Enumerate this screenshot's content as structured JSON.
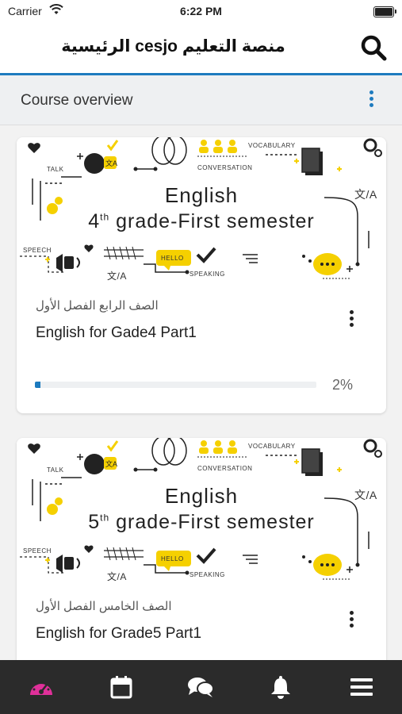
{
  "status_bar": {
    "carrier": "Carrier",
    "time": "6:22 PM"
  },
  "header": {
    "title": "الرئيسية cesjo منصة التعليم"
  },
  "overview": {
    "label": "Course overview"
  },
  "courses": [
    {
      "banner_title": "English",
      "banner_grade_num": "4",
      "banner_grade_sup": "th",
      "banner_grade_text": "grade-First semester",
      "category": "الصف الرابع الفصل الأول",
      "name": "English for Gade4 Part1",
      "progress": 2,
      "progress_label": "2%"
    },
    {
      "banner_title": "English",
      "banner_grade_num": "5",
      "banner_grade_sup": "th",
      "banner_grade_text": "grade-First semester",
      "category": "الصف الخامس الفصل الأول",
      "name": "English for Grade5 Part1"
    }
  ],
  "banner_tags": {
    "talk": "TALK",
    "vocabulary": "VOCABULARY",
    "conversation": "CONVERSATION",
    "speech": "SPEECH",
    "speaking": "SPEAKING",
    "hello": "HELLO",
    "translate": "文/A"
  },
  "tabs": [
    {
      "icon": "dashboard-icon",
      "active": true
    },
    {
      "icon": "calendar-icon"
    },
    {
      "icon": "messages-icon"
    },
    {
      "icon": "notifications-icon"
    },
    {
      "icon": "menu-icon"
    }
  ],
  "colors": {
    "accent": "#1d7bbf",
    "active_tab": "#e0309a",
    "banner_yellow": "#f5d000",
    "tabbar_bg": "#2b2b2b"
  }
}
